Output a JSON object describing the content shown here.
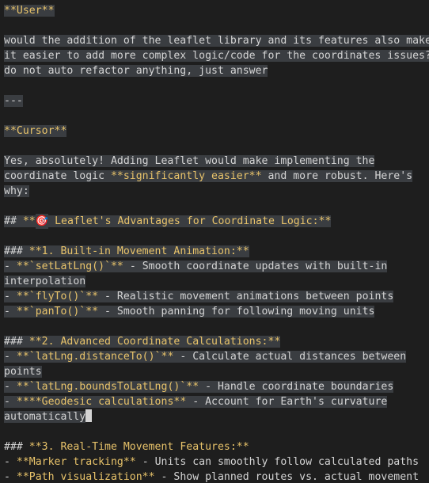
{
  "lines": [
    {
      "segments": [
        {
          "t": "**User**",
          "c": "y",
          "h": true
        }
      ]
    },
    {
      "segments": []
    },
    {
      "segments": [
        {
          "t": "would the addition of the leaflet library and its features also make",
          "c": "w",
          "h": true
        }
      ]
    },
    {
      "segments": [
        {
          "t": "it easier to add more complex logic/code for the coordinates issues?",
          "c": "w",
          "h": true
        }
      ]
    },
    {
      "segments": [
        {
          "t": "do not auto refactor anything, just answer",
          "c": "w",
          "h": true
        }
      ]
    },
    {
      "segments": []
    },
    {
      "segments": [
        {
          "t": "---",
          "c": "w",
          "h": true
        }
      ]
    },
    {
      "segments": []
    },
    {
      "segments": [
        {
          "t": "**Cursor**",
          "c": "y",
          "h": true
        }
      ]
    },
    {
      "segments": []
    },
    {
      "segments": [
        {
          "t": "Yes, absolutely! Adding Leaflet would make implementing the",
          "c": "w",
          "h": true
        }
      ]
    },
    {
      "segments": [
        {
          "t": "coordinate logic ",
          "c": "w",
          "h": true
        },
        {
          "t": "**significantly easier**",
          "c": "y",
          "h": true
        },
        {
          "t": " and more robust. Here's",
          "c": "w",
          "h": true
        }
      ]
    },
    {
      "segments": [
        {
          "t": "why:",
          "c": "w",
          "h": true
        }
      ]
    },
    {
      "segments": []
    },
    {
      "segments": [
        {
          "t": "## ",
          "c": "w",
          "h": true
        },
        {
          "t": "**",
          "c": "y",
          "h": true
        },
        {
          "t": "🎯",
          "c": "e",
          "h": true
        },
        {
          "t": " Leaflet's Advantages for Coordinate Logic:**",
          "c": "y",
          "h": true
        }
      ]
    },
    {
      "segments": []
    },
    {
      "segments": [
        {
          "t": "### ",
          "c": "w",
          "h": true
        },
        {
          "t": "**1. Built-in Movement Animation:**",
          "c": "y",
          "h": true
        }
      ]
    },
    {
      "segments": [
        {
          "t": "- ",
          "c": "w",
          "h": true
        },
        {
          "t": "**`setLatLng()`**",
          "c": "y",
          "h": true
        },
        {
          "t": " - Smooth coordinate updates with built-in",
          "c": "w",
          "h": true
        }
      ]
    },
    {
      "segments": [
        {
          "t": "interpolation",
          "c": "w",
          "h": true
        }
      ]
    },
    {
      "segments": [
        {
          "t": "- ",
          "c": "w",
          "h": true
        },
        {
          "t": "**`flyTo()`**",
          "c": "y",
          "h": true
        },
        {
          "t": " - Realistic movement animations between points",
          "c": "w",
          "h": true
        }
      ]
    },
    {
      "segments": [
        {
          "t": "- ",
          "c": "w",
          "h": true
        },
        {
          "t": "**`panTo()`**",
          "c": "y",
          "h": true
        },
        {
          "t": " - Smooth panning for following moving units",
          "c": "w",
          "h": true
        }
      ]
    },
    {
      "segments": []
    },
    {
      "segments": [
        {
          "t": "### ",
          "c": "w",
          "h": true
        },
        {
          "t": "**2. Advanced Coordinate Calculations:**",
          "c": "y",
          "h": true
        }
      ]
    },
    {
      "segments": [
        {
          "t": "- ",
          "c": "w",
          "h": true
        },
        {
          "t": "**`latLng.distanceTo()`**",
          "c": "y",
          "h": true
        },
        {
          "t": " - Calculate actual distances between",
          "c": "w",
          "h": true
        }
      ]
    },
    {
      "segments": [
        {
          "t": "points",
          "c": "w",
          "h": true
        }
      ]
    },
    {
      "segments": [
        {
          "t": "- ",
          "c": "w",
          "h": true
        },
        {
          "t": "**`latLng.boundsToLatLng()`**",
          "c": "y",
          "h": true
        },
        {
          "t": " - Handle coordinate boundaries",
          "c": "w",
          "h": true
        }
      ]
    },
    {
      "segments": [
        {
          "t": "- ",
          "c": "w",
          "h": true
        },
        {
          "t": "****Geodesic calculations**",
          "c": "y",
          "h": true
        },
        {
          "t": " - Account for Earth's curvature",
          "c": "w",
          "h": true
        }
      ]
    },
    {
      "segments": [
        {
          "t": "automatically",
          "c": "w",
          "h": true
        },
        {
          "t": "",
          "c": "cursor",
          "h": false
        }
      ]
    },
    {
      "segments": []
    },
    {
      "segments": [
        {
          "t": "### ",
          "c": "w",
          "h": false
        },
        {
          "t": "**3. Real-Time Movement Features:**",
          "c": "y",
          "h": false
        }
      ]
    },
    {
      "segments": [
        {
          "t": "- ",
          "c": "w",
          "h": false
        },
        {
          "t": "**Marker tracking**",
          "c": "y",
          "h": false
        },
        {
          "t": " - Units can smoothly follow calculated paths",
          "c": "w",
          "h": false
        }
      ]
    },
    {
      "segments": [
        {
          "t": "- ",
          "c": "w",
          "h": false
        },
        {
          "t": "**Path visualization**",
          "c": "y",
          "h": false
        },
        {
          "t": " - Show planned routes vs. actual movement",
          "c": "w",
          "h": false
        }
      ]
    }
  ],
  "colors": {
    "background": "#1e1e1e",
    "text": "#d4d4d4",
    "emphasis": "#e8c36a",
    "selection": "#3a3d41"
  }
}
